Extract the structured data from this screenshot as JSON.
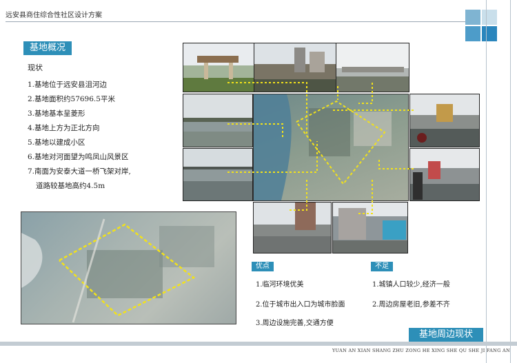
{
  "header": {
    "title": "远安县商住综合性社区设计方案"
  },
  "site_section": {
    "tag": "基地概况",
    "status_label": "现状",
    "points": [
      "1.基地位于远安县沮河边",
      "2.基地面积约57696.5平米",
      "3.基地基本呈菱形",
      "4.基地上方为正北方向",
      "5.基地以建成小区",
      "6.基地对河面望为鸣凤山风景区",
      "7.南面为安泰大道一桥飞架对岸,",
      "道路较基地高约4.5m"
    ]
  },
  "strengths": {
    "tag": "优点",
    "items": [
      "1.临河环境优美",
      "2.位于城市出入口为城市脸面",
      "3.周边设施完善,交通方便"
    ]
  },
  "weaknesses": {
    "tag": "不足",
    "items": [
      "1.城镇人口较少,经济一般",
      "2.周边房屋老旧,参差不齐"
    ]
  },
  "footer": {
    "tag": "基地周边现状",
    "pinyin": "YUAN AN XIAN SHANG ZHU ZONG HE XING SHE QU SHE JI FANG AN"
  },
  "colors": {
    "accent": "#2d8fb8",
    "marker": "#f2e21a"
  }
}
